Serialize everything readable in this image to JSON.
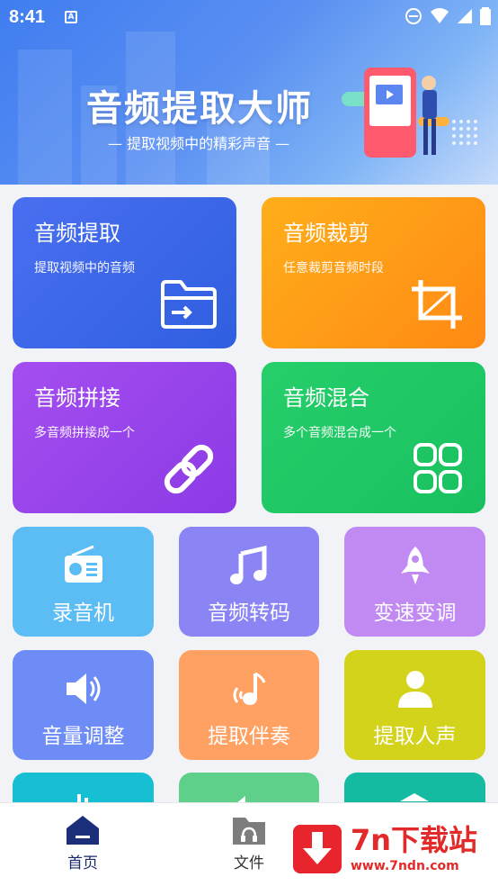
{
  "status_bar": {
    "time": "8:41",
    "notif_letter": "A"
  },
  "banner": {
    "title": "音频提取大师",
    "subtitle": "— 提取视频中的精彩声音 —"
  },
  "big_cards": {
    "extract": {
      "title": "音频提取",
      "desc": "提取视频中的音频",
      "icon": "folder-import-icon",
      "color": "#3f66ea"
    },
    "cut": {
      "title": "音频裁剪",
      "desc": "任意裁剪音频时段",
      "icon": "crop-icon",
      "color": "#ff9a16"
    },
    "join": {
      "title": "音频拼接",
      "desc": "多音频拼接成一个",
      "icon": "link-icon",
      "color": "#9a45ec"
    },
    "mix": {
      "title": "音频混合",
      "desc": "多个音频混合成一个",
      "icon": "grid-icon",
      "color": "#20c866"
    }
  },
  "small_cards": {
    "recorder": {
      "label": "录音机",
      "icon": "radio-icon"
    },
    "transcode": {
      "label": "音频转码",
      "icon": "music-note-icon"
    },
    "speed": {
      "label": "变速变调",
      "icon": "rocket-icon"
    },
    "volume": {
      "label": "音量调整",
      "icon": "speaker-icon"
    },
    "accompaniment": {
      "label": "提取伴奏",
      "icon": "music-signal-icon"
    },
    "vocal": {
      "label": "提取人声",
      "icon": "person-icon"
    }
  },
  "bottom_nav": {
    "home": "首页",
    "files": "文件"
  },
  "watermark": {
    "title": "7n下载站",
    "url": "www.7ndn.com"
  }
}
